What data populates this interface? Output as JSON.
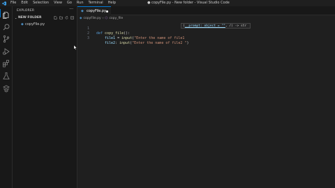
{
  "titlebar": {
    "menu": [
      "File",
      "Edit",
      "Selection",
      "View",
      "Go",
      "Run",
      "Terminal",
      "Help"
    ],
    "window_title": "● copyFile.py - New folder - Visual Studio Code"
  },
  "sidebar": {
    "title": "EXPLORER",
    "more": "···",
    "folder_name": "NEW FOLDER",
    "files": [
      {
        "name": "copyFile.py"
      }
    ]
  },
  "tab": {
    "name": "copyFile.py"
  },
  "breadcrumb": {
    "file": "copyFile.py",
    "sep": "›",
    "symbol": "copy_file"
  },
  "code": {
    "lines": [
      {
        "n": "1",
        "kw": "def ",
        "fn": "copy_file",
        "rest": "():"
      },
      {
        "n": "2",
        "var": "file1",
        "eq": " = ",
        "call": "input",
        "open": "(",
        "str": "\"Enter the name of file1"
      },
      {
        "n": "3",
        "var": "file2",
        "eq": ": ",
        "call": "input",
        "open": "(",
        "str": "\"Enter the name of file2 \"",
        "close": ")"
      }
    ]
  },
  "hint": {
    "param": "__prompt: object = \"\"",
    "rest": ", /) -> str"
  },
  "colors": {
    "accent": "#0078d4",
    "background": "#1f1f1f"
  }
}
